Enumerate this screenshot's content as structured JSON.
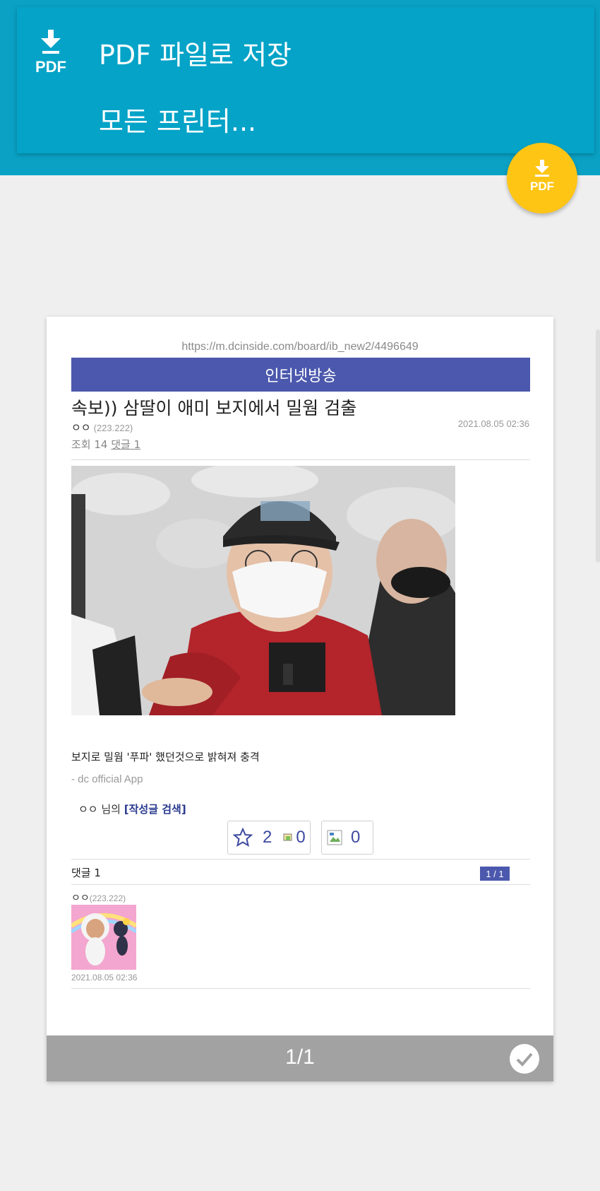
{
  "menu": {
    "items": [
      {
        "label": "PDF 파일로 저장",
        "icon": "pdf-download-icon"
      },
      {
        "label": "모든 프린터..."
      }
    ],
    "icon_text": "PDF"
  },
  "fab": {
    "icon": "pdf-download-icon",
    "text": "PDF"
  },
  "preview": {
    "url": "https://m.dcinside.com/board/ib_new2/4496649",
    "category": "인터넷방송",
    "title": "속보)) 삼딸이 애미 보지에서 밀웜 검출",
    "author": "ㅇㅇ",
    "author_ip": "(223.222)",
    "date": "2021.08.05 02:36",
    "views_label": "조회 14",
    "comments_link": "댓글 1",
    "body_text": "보지로 밀웜 '푸파' 했던것으로 밝혀져 충격",
    "app_sig": "- dc official App",
    "byline_name": "ㅇㅇ 님의",
    "byline_link": "[작성글 검색]",
    "vote_up": "2",
    "vote_fix": "0",
    "vote_down": "0",
    "comment_header": "댓글 1",
    "comment_pager": "1 / 1",
    "comment_author": "ㅇㅇ",
    "comment_ip": "(223.222)",
    "comment_date": "2021.08.05 02:36"
  },
  "footer": {
    "page_counter": "1/1"
  },
  "colors": {
    "header": "#04a3c7",
    "fab": "#ffc515",
    "category_bar": "#4b58ad"
  }
}
